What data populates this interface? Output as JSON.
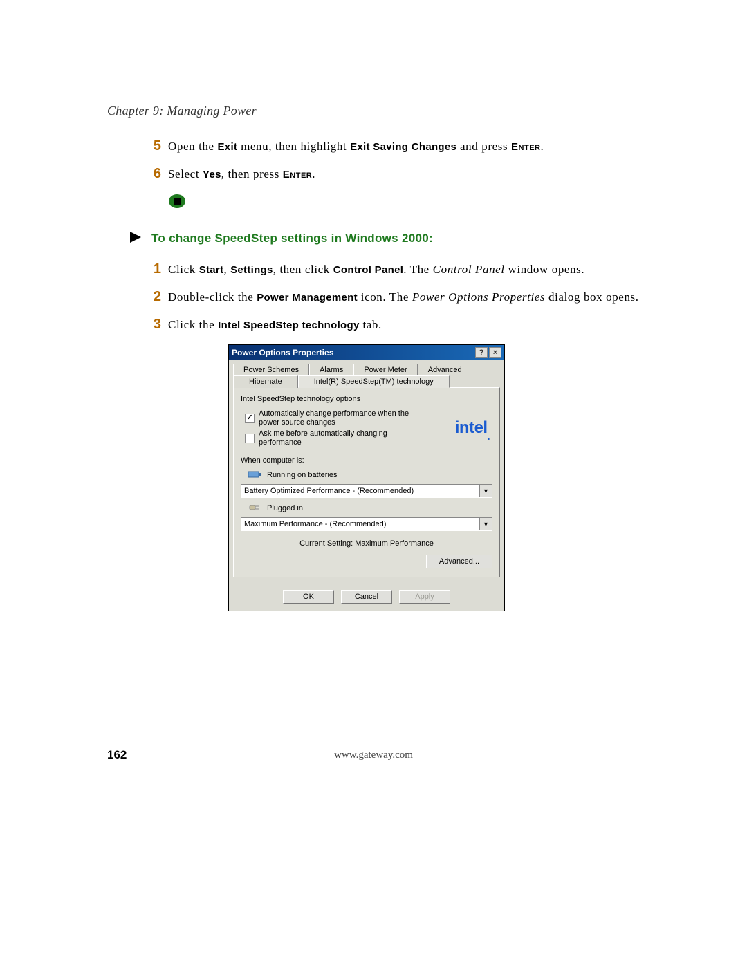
{
  "chapter": "Chapter 9: Managing Power",
  "steps_a": [
    {
      "n": "5",
      "pre": "Open the ",
      "b1": "Exit",
      "mid": " menu, then highlight ",
      "b2": "Exit Saving Changes",
      "post": " and press ",
      "sc": "Enter",
      "tail": "."
    },
    {
      "n": "6",
      "pre": "Select ",
      "b1": "Yes",
      "mid": ", then press ",
      "sc": "Enter",
      "tail": "."
    }
  ],
  "section_title": "To change SpeedStep settings in Windows 2000:",
  "steps_b": [
    {
      "n": "1",
      "pre": "Click ",
      "b1": "Start",
      "mid1": ", ",
      "b2": "Settings",
      "mid2": ", then click ",
      "b3": "Control Panel",
      "post": ". The ",
      "it": "Control Panel",
      "tail": " window opens."
    },
    {
      "n": "2",
      "pre": "Double-click the ",
      "b1": "Power Management",
      "mid": " icon. The ",
      "it": "Power Options Properties",
      "tail": " dialog box opens."
    },
    {
      "n": "3",
      "pre": "Click the ",
      "b1": "Intel SpeedStep technology",
      "tail": " tab."
    }
  ],
  "dialog": {
    "title": "Power Options Properties",
    "help_btn": "?",
    "close_btn": "×",
    "tabs_row1": [
      "Power Schemes",
      "Alarms",
      "Power Meter",
      "Advanced"
    ],
    "tabs_row2": [
      "Hibernate",
      "Intel(R) SpeedStep(TM) technology"
    ],
    "active_tab": "Intel(R) SpeedStep(TM) technology",
    "group_title": "Intel SpeedStep technology options",
    "check1": {
      "checked": true,
      "label": "Automatically change performance when the power source changes"
    },
    "check2": {
      "checked": false,
      "label": "Ask me before automatically changing performance"
    },
    "logo_text": "intel",
    "when_label": "When computer is:",
    "battery_label": "Running on batteries",
    "battery_select": "Battery Optimized Performance - (Recommended)",
    "plugged_label": "Plugged in",
    "plugged_select": "Maximum Performance - (Recommended)",
    "current_label": "Current Setting:  Maximum Performance",
    "advanced_btn": "Advanced...",
    "ok": "OK",
    "cancel": "Cancel",
    "apply": "Apply"
  },
  "page_number": "162",
  "footer_url": "www.gateway.com"
}
